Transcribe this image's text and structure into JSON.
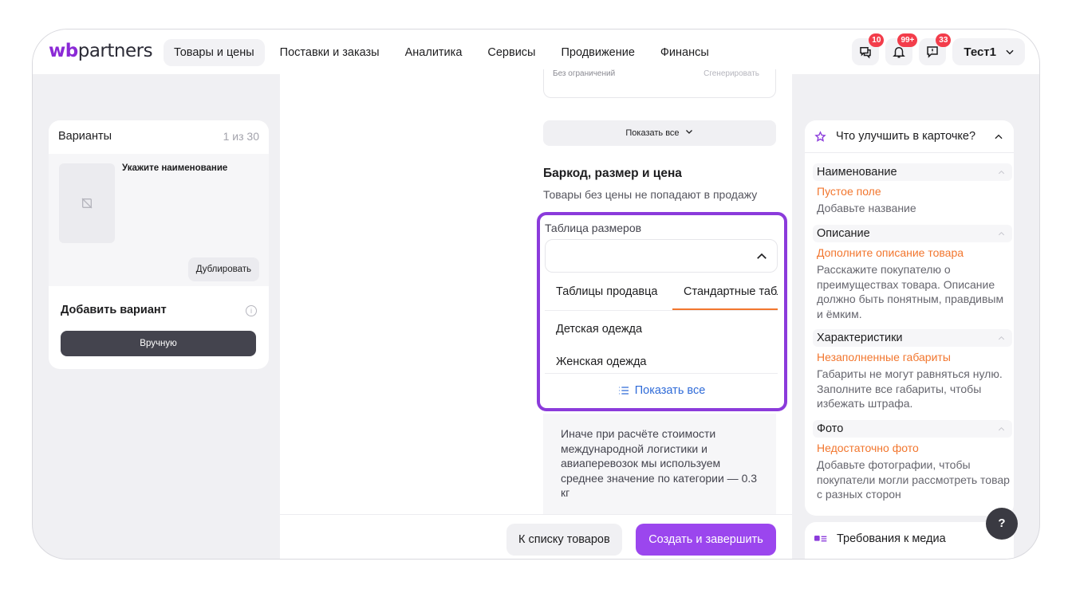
{
  "logo": {
    "wb": "wb",
    "partners": "partners"
  },
  "nav": [
    "Товары и цены",
    "Поставки и заказы",
    "Аналитика",
    "Сервисы",
    "Продвижение",
    "Финансы"
  ],
  "header_icons": [
    {
      "icon": "chat-icon",
      "badge": "10"
    },
    {
      "icon": "bell-icon",
      "badge": "99+"
    },
    {
      "icon": "feedback-icon",
      "badge": "33"
    }
  ],
  "user": {
    "name": "Тест1"
  },
  "variants": {
    "title": "Варианты",
    "count": "1 из 30",
    "item_name": "Укажите наименование",
    "duplicate": "Дублировать",
    "add_title": "Добавить вариант",
    "info": "i",
    "manual": "Вручную"
  },
  "center": {
    "gen_left": "Без ограничений",
    "gen_right": "Сгенерировать",
    "show_all": "Показать все",
    "section_title": "Баркод, размер и цена",
    "section_sub": "Товары без цены не попадают в продажу",
    "size_table": {
      "label": "Таблица размеров",
      "tabs": [
        "Таблицы продавца",
        "Стандартные таблицы"
      ],
      "options": [
        "Детская одежда",
        "Женская одежда"
      ],
      "show_all": "Показать все"
    },
    "note": "Иначе при расчёте стоимости международной логистики и авиаперевозок мы используем среднее значение по категории — 0.3 кг"
  },
  "actions": {
    "to_list": "К списку товаров",
    "create": "Создать и завершить"
  },
  "improve": {
    "title": "Что улучшить в карточке?",
    "sections": [
      {
        "title": "Наименование",
        "warn": "Пустое поле",
        "desc": "Добавьте название"
      },
      {
        "title": "Описание",
        "warn": "Дополните описание товара",
        "desc": "Расскажите покупателю о преимуществах товара. Описание должно быть понятным, правдивым и ёмким."
      },
      {
        "title": "Характеристики",
        "warn": "Незаполненные габариты",
        "desc": "Габариты не могут равняться нулю. Заполните все габариты, чтобы избежать штрафа."
      },
      {
        "title": "Фото",
        "warn": "Недостаточно фото",
        "desc": "Добавьте фотографии, чтобы покупатели могли рассмотреть товар с разных сторон"
      }
    ]
  },
  "media": {
    "title": "Требования к медиа"
  },
  "help": "?",
  "colors": {
    "accent": "#9b46ee",
    "warning": "#f2762e",
    "link": "#2f6bd8",
    "badge": "#f33d4b"
  }
}
